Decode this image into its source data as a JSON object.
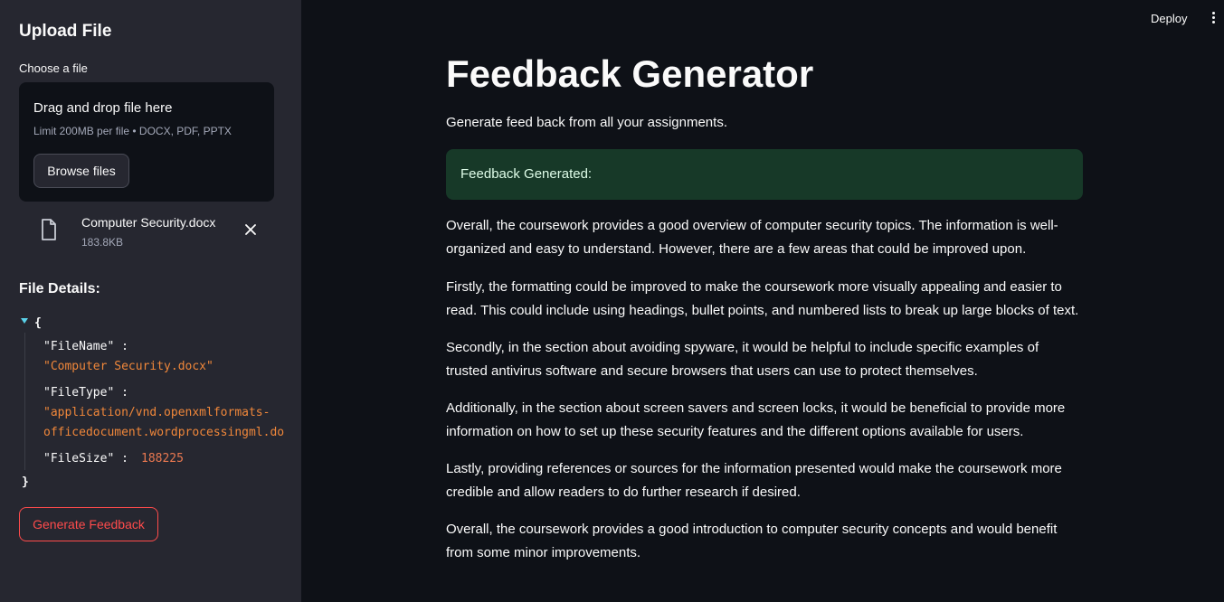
{
  "sidebar": {
    "title": "Upload File",
    "uploader_label": "Choose a file",
    "dropzone": {
      "title": "Drag and drop file here",
      "limit": "Limit 200MB per file • DOCX, PDF, PPTX",
      "browse_label": "Browse files"
    },
    "file": {
      "name": "Computer Security.docx",
      "size": "183.8KB"
    },
    "details_title": "File Details:",
    "json": {
      "open_brace": "{",
      "close_brace": "}",
      "filename_key": "\"FileName\" :",
      "filename_value": "\"Computer Security.docx\"",
      "filetype_key": "\"FileType\" :",
      "filetype_value_line1": "\"application/vnd.openxmlformats-",
      "filetype_value_line2": "officedocument.wordprocessingml.do",
      "filesize_key": "\"FileSize\" :",
      "filesize_value": "188225"
    },
    "generate_label": "Generate Feedback"
  },
  "header": {
    "deploy_label": "Deploy"
  },
  "main": {
    "title": "Feedback Generator",
    "subtitle": "Generate feed back from all your assignments.",
    "alert": "Feedback Generated:",
    "paragraphs": [
      "Overall, the coursework provides a good overview of computer security topics. The information is well-organized and easy to understand. However, there are a few areas that could be improved upon.",
      "Firstly, the formatting could be improved to make the coursework more visually appealing and easier to read. This could include using headings, bullet points, and numbered lists to break up large blocks of text.",
      "Secondly, in the section about avoiding spyware, it would be helpful to include specific examples of trusted antivirus software and secure browsers that users can use to protect themselves.",
      "Additionally, in the section about screen savers and screen locks, it would be beneficial to provide more information on how to set up these security features and the different options available for users.",
      "Lastly, providing references or sources for the information presented would make the coursework more credible and allow readers to do further research if desired.",
      "Overall, the coursework provides a good introduction to computer security concepts and would benefit from some minor improvements."
    ]
  },
  "colors": {
    "accent": "#ff4b4b",
    "success_bg": "#173928",
    "json_string": "#f0873a"
  },
  "icons": {
    "file": "file-icon",
    "close": "close-icon",
    "menu": "kebab-menu-icon",
    "toggle": "caret-down-icon"
  }
}
